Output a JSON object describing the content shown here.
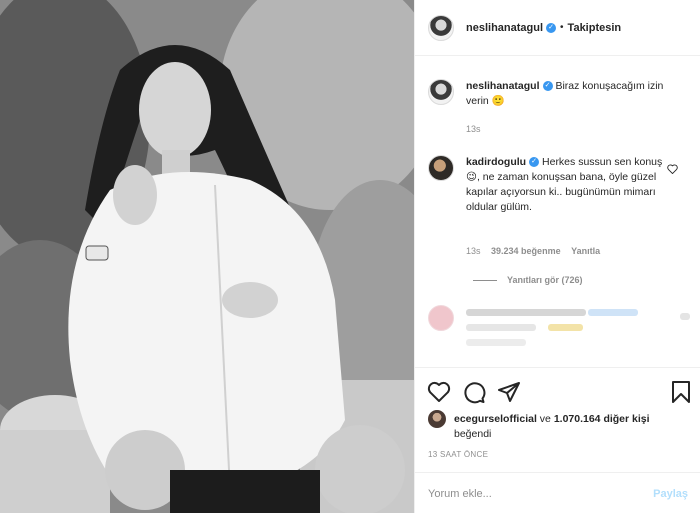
{
  "header": {
    "username": "neslihanatagul",
    "separator": "•",
    "follow_status": "Takiptesin"
  },
  "caption": {
    "username": "neslihanatagul",
    "text": "Biraz konuşacağım izin verin 🙂",
    "time": "13s"
  },
  "comment": {
    "username": "kadirdogulu",
    "text": "Herkes sussun sen konuş 😉, ne zaman konuşsan bana, öyle güzel kapılar açıyorsun ki.. bugünümün mimarı oldular gülüm.",
    "time": "13s",
    "likes": "39.234 beğenme",
    "reply_label": "Yanıtla",
    "view_replies": "Yanıtları gör (726)"
  },
  "likes": {
    "first_user": "ecegurselofficial",
    "connector": "ve",
    "others": "1.070.164 diğer kişi",
    "suffix": "beğendi"
  },
  "post_time": "13 SAAT ÖNCE",
  "composer": {
    "placeholder": "Yorum ekle...",
    "post_label": "Paylaş"
  },
  "colors": {
    "accent": "#3897f0",
    "post_disabled": "#b2dffc",
    "muted": "#8e8e8e"
  },
  "icons": [
    "heart-icon",
    "comment-icon",
    "share-icon",
    "bookmark-icon"
  ]
}
